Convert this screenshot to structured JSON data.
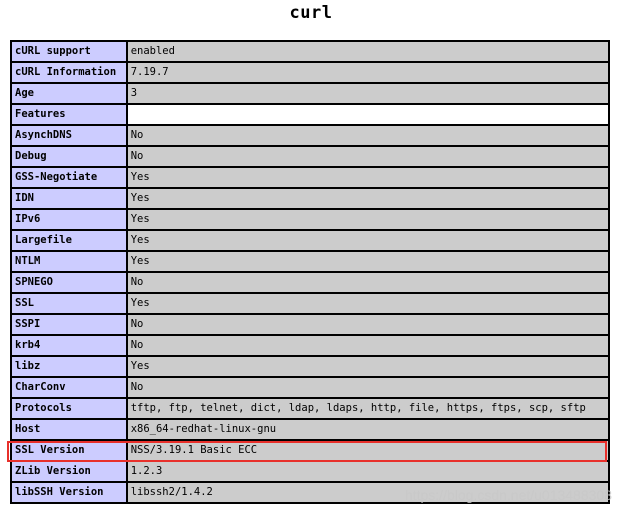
{
  "title": "curl",
  "rows": [
    {
      "key": "cURL support",
      "value": "enabled"
    },
    {
      "key": "cURL Information",
      "value": "7.19.7"
    },
    {
      "key": "Age",
      "value": "3"
    },
    {
      "key": "Features",
      "value": ""
    },
    {
      "key": "AsynchDNS",
      "value": "No"
    },
    {
      "key": "Debug",
      "value": "No"
    },
    {
      "key": "GSS-Negotiate",
      "value": "Yes"
    },
    {
      "key": "IDN",
      "value": "Yes"
    },
    {
      "key": "IPv6",
      "value": "Yes"
    },
    {
      "key": "Largefile",
      "value": "Yes"
    },
    {
      "key": "NTLM",
      "value": "Yes"
    },
    {
      "key": "SPNEGO",
      "value": "No"
    },
    {
      "key": "SSL",
      "value": "Yes"
    },
    {
      "key": "SSPI",
      "value": "No"
    },
    {
      "key": "krb4",
      "value": "No"
    },
    {
      "key": "libz",
      "value": "Yes"
    },
    {
      "key": "CharConv",
      "value": "No"
    },
    {
      "key": "Protocols",
      "value": "tftp, ftp, telnet, dict, ldap, ldaps, http, file, https, ftps, scp, sftp"
    },
    {
      "key": "Host",
      "value": "x86_64-redhat-linux-gnu"
    },
    {
      "key": "SSL Version",
      "value": "NSS/3.19.1 Basic ECC"
    },
    {
      "key": "ZLib Version",
      "value": "1.2.3"
    },
    {
      "key": "libSSH Version",
      "value": "libssh2/1.4.2"
    }
  ],
  "highlighted_row": "SSL Version",
  "watermark": "https://blog.csdn.net/u013488308",
  "colors": {
    "key_cell": "#ccccff",
    "value_cell": "#cccccc",
    "highlight": "#e8302b"
  }
}
